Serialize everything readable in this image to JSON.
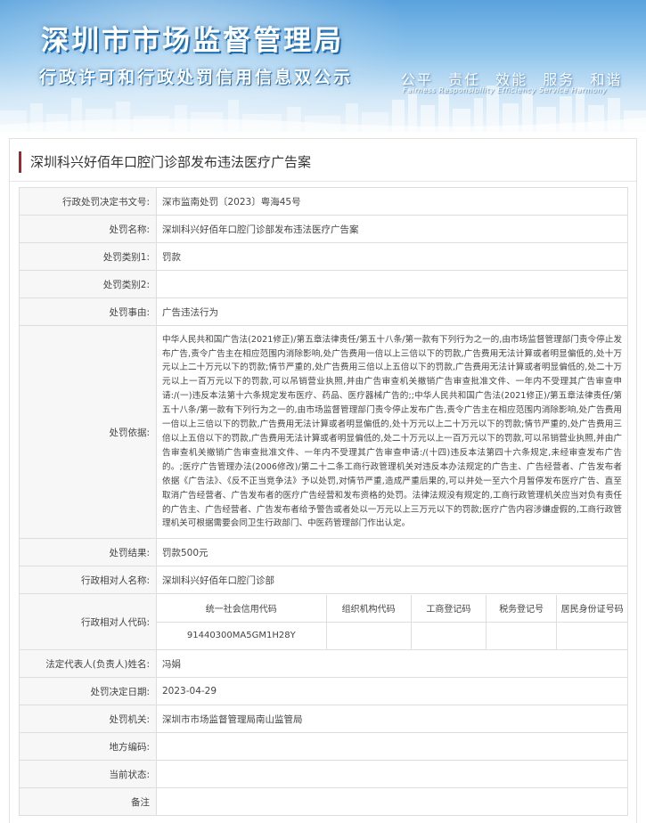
{
  "banner": {
    "title_main": "深圳市市场监督管理局",
    "title_sub": "行政许可和行政处罚信用信息双公示",
    "slogan": "公平 责任 效能 服务 和谐",
    "slogan_en": "Fairness  Responsibility  Efficiency  Service  Harmony",
    "colors": {
      "sky_top": "#5aa2dd",
      "text_shadow": "#1f6fb1"
    }
  },
  "case": {
    "title": "深圳科兴好佰年口腔门诊部发布违法医疗广告案",
    "accent_color": "#a3262a"
  },
  "fields": {
    "doc_no": {
      "label": "行政处罚决定书文号:",
      "value": "深市监南处罚〔2023〕粤海45号"
    },
    "penalty_name": {
      "label": "处罚名称:",
      "value": "深圳科兴好佰年口腔门诊部发布违法医疗广告案"
    },
    "category1": {
      "label": "处罚类别1:",
      "value": "罚款"
    },
    "category2": {
      "label": "处罚类别2:",
      "value": ""
    },
    "reason": {
      "label": "处罚事由:",
      "value": "广告违法行为"
    },
    "basis": {
      "label": "处罚依据:",
      "value": "中华人民共和国广告法(2021修正)/第五章法律责任/第五十八条/第一款有下列行为之一的,由市场监督管理部门责令停止发布广告,责令广告主在相应范围内消除影响,处广告费用一倍以上三倍以下的罚款,广告费用无法计算或者明显偏低的,处十万元以上二十万元以下的罚款;情节严重的,处广告费用三倍以上五倍以下的罚款,广告费用无法计算或者明显偏低的,处二十万元以上一百万元以下的罚款,可以吊销营业执照,并由广告审查机关撤销广告审查批准文件、一年内不受理其广告审查申请:/(一)违反本法第十六条规定发布医疗、药品、医疗器械广告的;;中华人民共和国广告法(2021修正)/第五章法律责任/第五十八条/第一款有下列行为之一的,由市场监督管理部门责令停止发布广告,责令广告主在相应范围内消除影响,处广告费用一倍以上三倍以下的罚款,广告费用无法计算或者明显偏低的,处十万元以上二十万元以下的罚款;情节严重的,处广告费用三倍以上五倍以下的罚款,广告费用无法计算或者明显偏低的,处二十万元以上一百万元以下的罚款,可以吊销营业执照,并由广告审查机关撤销广告审查批准文件、一年内不受理其广告审查申请:/(十四)违反本法第四十六条规定,未经审查发布广告的。;医疗广告管理办法(2006修改)/第二十二条工商行政管理机关对违反本办法规定的广告主、广告经营者、广告发布者依据《广告法》、《反不正当竞争法》予以处罚,对情节严重,造成严重后果的,可以并处一至六个月暂停发布医疗广告、直至取消广告经营者、广告发布者的医疗广告经营和发布资格的处罚。法律法规没有规定的,工商行政管理机关应当对负有责任的广告主、广告经营者、广告发布者给予警告或者处以一万元以上三万元以下的罚款;医疗广告内容涉嫌虚假的,工商行政管理机关可根据需要会同卫生行政部门、中医药管理部门作出认定。"
    },
    "result": {
      "label": "处罚结果:",
      "value": "罚款500元"
    },
    "party_name": {
      "label": "行政相对人名称:",
      "value": "深圳科兴好佰年口腔门诊部"
    },
    "party_codes": {
      "label": "行政相对人代码:",
      "headers": [
        "统一社会信用代码",
        "组织机构代码",
        "工商登记码",
        "税务登记号",
        "居民身份证号码"
      ],
      "values": [
        "91440300MA5GM1H28Y",
        "",
        "",
        "",
        ""
      ]
    },
    "legal_rep": {
      "label": "法定代表人(负责人)姓名:",
      "value": "冯娟"
    },
    "decision_date": {
      "label": "处罚决定日期:",
      "value": "2023-04-29"
    },
    "authority": {
      "label": "处罚机关:",
      "value": "深圳市市场监督管理局南山监管局"
    },
    "local_code": {
      "label": "地方编码:",
      "value": ""
    },
    "status": {
      "label": "当前状态:",
      "value": ""
    },
    "remarks": {
      "label": "备注",
      "value": ""
    }
  }
}
